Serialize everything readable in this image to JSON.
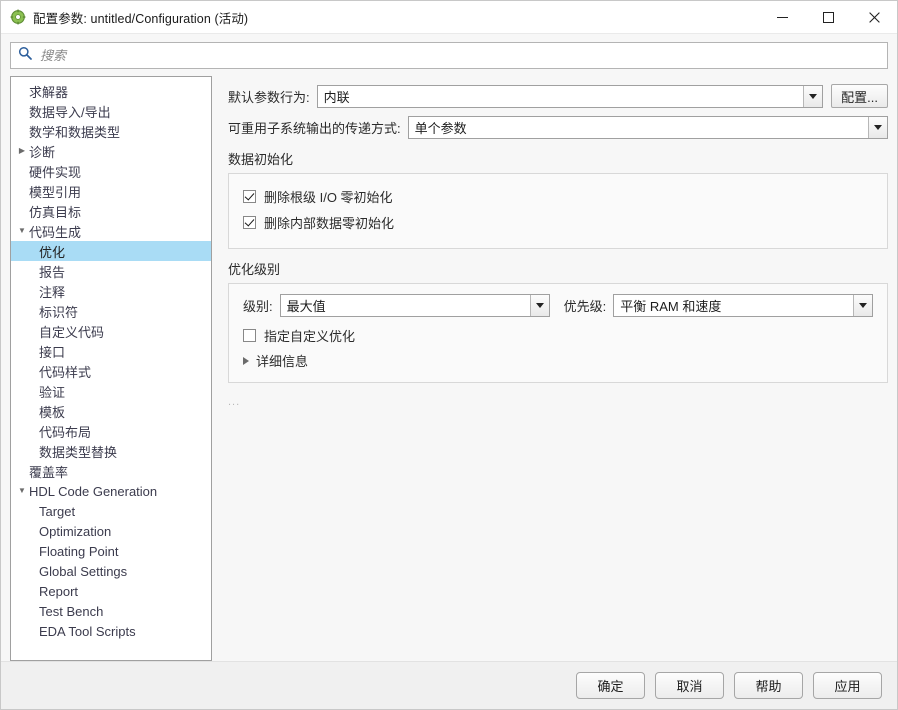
{
  "titlebar": {
    "icon": "simulink-config-icon",
    "title": "配置参数: untitled/Configuration (活动)",
    "minimize": "—",
    "maximize": "□",
    "close": "✕"
  },
  "search": {
    "icon": "search-icon",
    "placeholder": "搜索",
    "value": ""
  },
  "sidebar": {
    "items": [
      {
        "label": "求解器",
        "level": 0,
        "twisty": "none",
        "selected": false
      },
      {
        "label": "数据导入/导出",
        "level": 0,
        "twisty": "none",
        "selected": false
      },
      {
        "label": "数学和数据类型",
        "level": 0,
        "twisty": "none",
        "selected": false
      },
      {
        "label": "诊断",
        "level": 0,
        "twisty": "collapsed",
        "selected": false
      },
      {
        "label": "硬件实现",
        "level": 0,
        "twisty": "none",
        "selected": false
      },
      {
        "label": "模型引用",
        "level": 0,
        "twisty": "none",
        "selected": false
      },
      {
        "label": "仿真目标",
        "level": 0,
        "twisty": "none",
        "selected": false
      },
      {
        "label": "代码生成",
        "level": 0,
        "twisty": "expanded",
        "selected": false
      },
      {
        "label": "优化",
        "level": 1,
        "twisty": "none",
        "selected": true
      },
      {
        "label": "报告",
        "level": 1,
        "twisty": "none",
        "selected": false
      },
      {
        "label": "注释",
        "level": 1,
        "twisty": "none",
        "selected": false
      },
      {
        "label": "标识符",
        "level": 1,
        "twisty": "none",
        "selected": false
      },
      {
        "label": "自定义代码",
        "level": 1,
        "twisty": "none",
        "selected": false
      },
      {
        "label": "接口",
        "level": 1,
        "twisty": "none",
        "selected": false
      },
      {
        "label": "代码样式",
        "level": 1,
        "twisty": "none",
        "selected": false
      },
      {
        "label": "验证",
        "level": 1,
        "twisty": "none",
        "selected": false
      },
      {
        "label": "模板",
        "level": 1,
        "twisty": "none",
        "selected": false
      },
      {
        "label": "代码布局",
        "level": 1,
        "twisty": "none",
        "selected": false
      },
      {
        "label": "数据类型替换",
        "level": 1,
        "twisty": "none",
        "selected": false
      },
      {
        "label": "覆盖率",
        "level": 0,
        "twisty": "none",
        "selected": false
      },
      {
        "label": "HDL Code Generation",
        "level": 0,
        "twisty": "expanded",
        "selected": false
      },
      {
        "label": "Target",
        "level": 1,
        "twisty": "none",
        "selected": false
      },
      {
        "label": "Optimization",
        "level": 1,
        "twisty": "none",
        "selected": false
      },
      {
        "label": "Floating Point",
        "level": 1,
        "twisty": "none",
        "selected": false
      },
      {
        "label": "Global Settings",
        "level": 1,
        "twisty": "none",
        "selected": false
      },
      {
        "label": "Report",
        "level": 1,
        "twisty": "none",
        "selected": false
      },
      {
        "label": "Test Bench",
        "level": 1,
        "twisty": "none",
        "selected": false
      },
      {
        "label": "EDA Tool Scripts",
        "level": 1,
        "twisty": "none",
        "selected": false
      }
    ]
  },
  "main": {
    "default_param_behavior": {
      "label": "默认参数行为:",
      "value": "内联",
      "configure_button": "配置..."
    },
    "reusable_subsystem_output": {
      "label": "可重用子系统输出的传递方式:",
      "value": "单个参数"
    },
    "data_init": {
      "group_title": "数据初始化",
      "checkboxes": [
        {
          "label": "删除根级 I/O 零初始化",
          "checked": true
        },
        {
          "label": "删除内部数据零初始化",
          "checked": true
        }
      ]
    },
    "optimization_level": {
      "group_title": "优化级别",
      "level": {
        "label": "级别:",
        "value": "最大值"
      },
      "priority": {
        "label": "优先级:",
        "value": "平衡 RAM 和速度"
      },
      "custom_opt": {
        "label": "指定自定义优化",
        "checked": false
      },
      "details": {
        "label": "详细信息",
        "expanded": false
      }
    },
    "overflow_note": "..."
  },
  "footer": {
    "ok": "确定",
    "cancel": "取消",
    "help": "帮助",
    "apply": "应用"
  },
  "colors": {
    "selection": "#a9dcf5",
    "icon_green": "#7db84a",
    "search_icon": "#2d5f9c"
  }
}
